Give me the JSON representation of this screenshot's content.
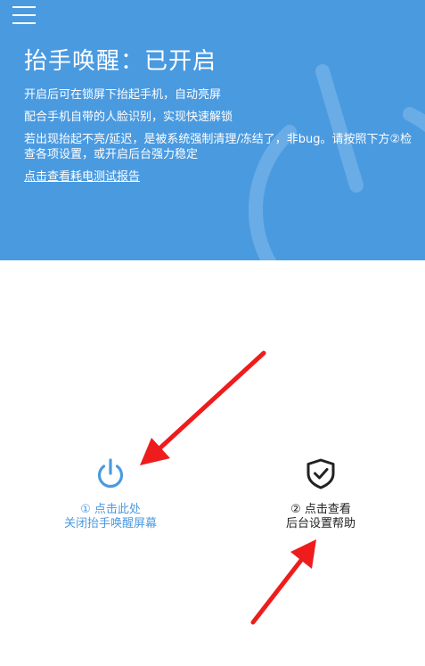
{
  "header": {
    "title": "抬手唤醒：已开启",
    "lines": [
      "开启后可在锁屏下抬起手机，自动亮屏",
      "配合手机自带的人脸识别，实现快速解锁",
      "若出现抬起不亮/延迟，是被系统强制清理/冻结了，非bug。请按照下方②检查各项设置，或开启后台强力稳定"
    ],
    "report_link": "点击查看耗电测试报告"
  },
  "actions": {
    "power": {
      "icon": "power-icon",
      "line1": "① 点击此处",
      "line2": "关闭抬手唤醒屏幕"
    },
    "help": {
      "icon": "shield-check-icon",
      "line1": "② 点击查看",
      "line2": "后台设置帮助"
    }
  },
  "colors": {
    "primary": "#4a9ae0",
    "arrow": "#ee1c1c",
    "text_dark": "#222222"
  }
}
